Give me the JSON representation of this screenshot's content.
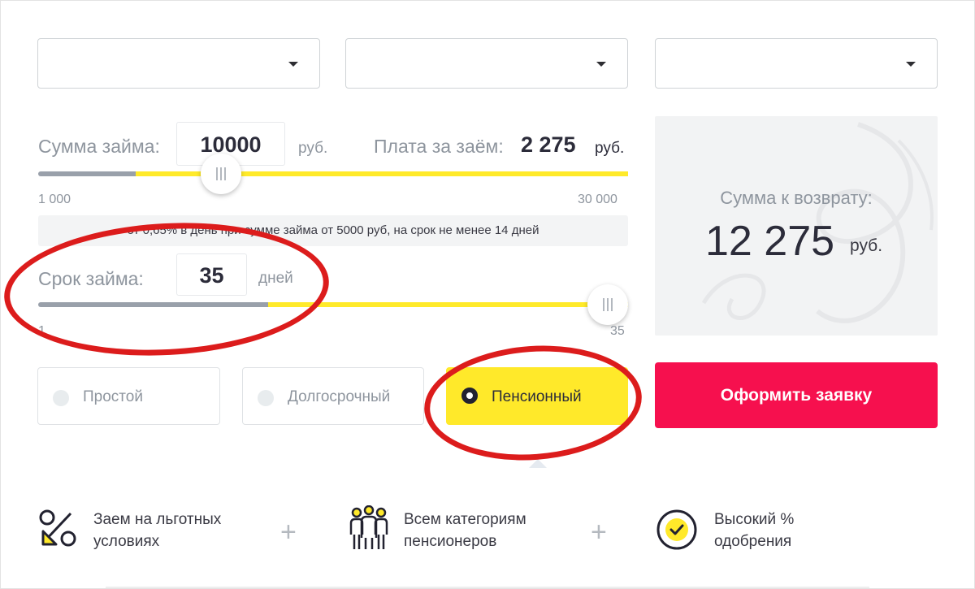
{
  "selects": [
    {
      "value": ""
    },
    {
      "value": ""
    },
    {
      "value": ""
    }
  ],
  "amount": {
    "label": "Сумма займа:",
    "value": "10000",
    "unit": "руб.",
    "fee_label": "Плата за заём:",
    "fee_value": "2 275",
    "fee_unit": "руб.",
    "min": "1 000",
    "max": "30 000",
    "slider_fraction": 0.31
  },
  "rate_note": "от 0,65% в день при сумме займа от 5000 руб, на срок не менее 14 дней",
  "term": {
    "label": "Срок займа:",
    "value": "35",
    "unit": "дней",
    "min": "1",
    "max": "35",
    "slider_fraction": 1.0
  },
  "tabs": [
    {
      "label": "Простой",
      "active": false
    },
    {
      "label": "Долгосрочный",
      "active": false
    },
    {
      "label": "Пенсионный",
      "active": true
    }
  ],
  "summary": {
    "label": "Сумма к возврату:",
    "value": "12 275",
    "unit": "руб."
  },
  "apply_button": "Оформить заявку",
  "features": [
    {
      "icon": "percent-discount-icon",
      "text": [
        "Заем на льготных",
        "условиях"
      ]
    },
    {
      "icon": "people-group-icon",
      "text": [
        "Всем категориям",
        "пенсионеров"
      ]
    },
    {
      "icon": "check-circle-icon",
      "text": [
        "Высокий %",
        "одобрения"
      ]
    }
  ],
  "plus_sign": "+",
  "colors": {
    "accent_yellow": "#ffea2a",
    "accent_red": "#f6104e",
    "annotation_red": "#dc1c1c",
    "muted_text": "#8e959e"
  }
}
